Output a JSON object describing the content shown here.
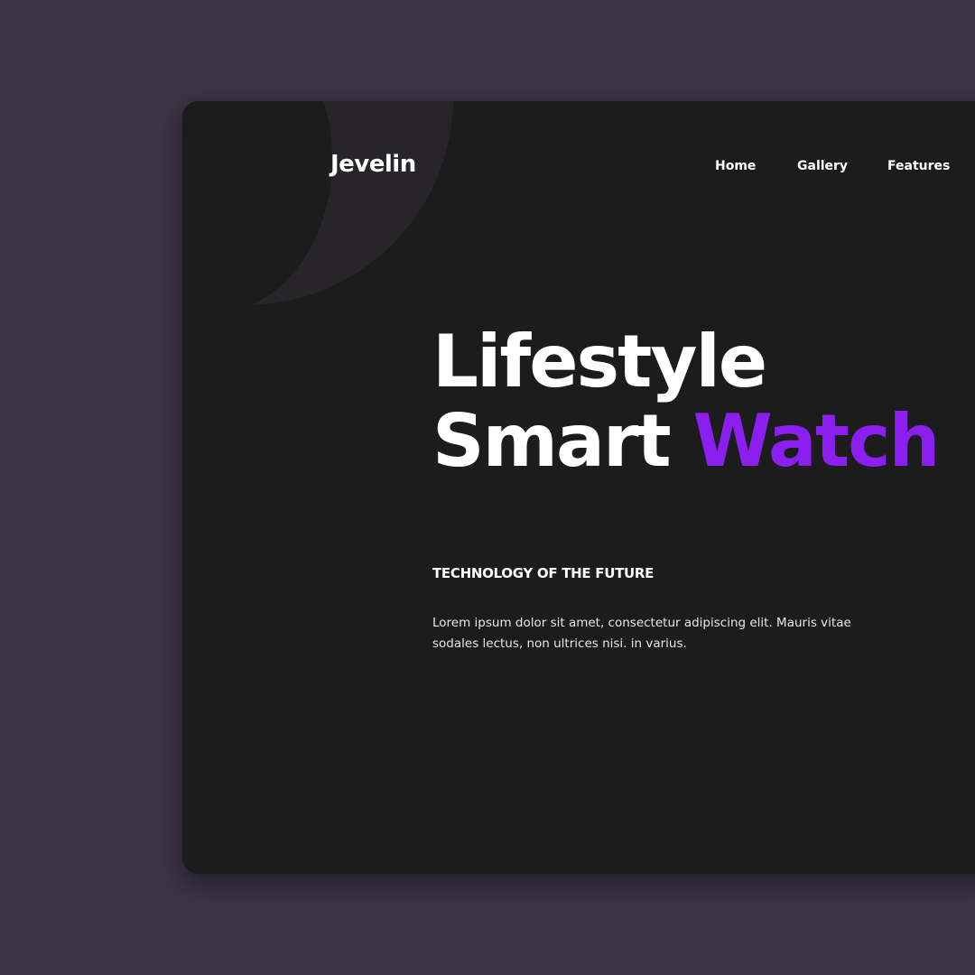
{
  "brand": {
    "logo": "Jevelin"
  },
  "nav": {
    "items": [
      "Home",
      "Gallery",
      "Features"
    ]
  },
  "hero": {
    "headline_line1": "Lifestyle",
    "headline_line2_plain": "Smart",
    "headline_line2_accent": "Watch",
    "tagline": "TECHNOLOGY OF THE FUTURE",
    "body": "Lorem ipsum dolor sit amet, consectetur adipiscing elit. Mauris vitae sodales lectus, non ultrices nisi. in varius."
  },
  "colors": {
    "background": "#3d3447",
    "card": "#1c1c1d",
    "ring": "#272529",
    "accent": "#8a1ff0",
    "text": "#ffffff"
  }
}
